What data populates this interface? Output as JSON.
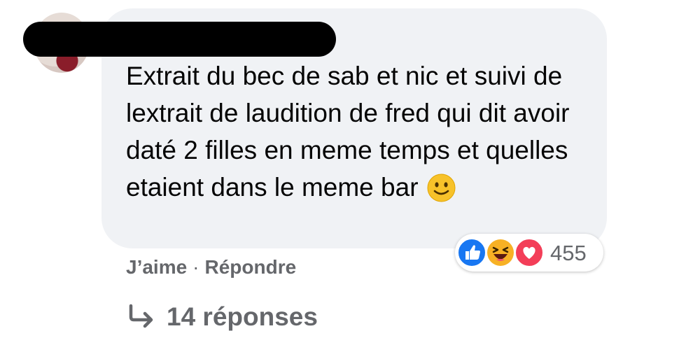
{
  "comment": {
    "text": "Extrait du bec de sab et nic et suivi de lextrait de laudition de fred qui dit avoir daté 2 filles en meme temps et quelles etaient dans le meme bar",
    "emoji": "slightly-smiling-face"
  },
  "reactions": {
    "icons": [
      "like-icon",
      "haha-icon",
      "love-icon"
    ],
    "count": "455"
  },
  "actions": {
    "like_label": "J’aime",
    "separator": "·",
    "reply_label": "Répondre"
  },
  "replies": {
    "label": "14 réponses",
    "icon": "reply-arrow-icon"
  },
  "colors": {
    "bubble": "#f0f2f5",
    "secondary_text": "#65676b",
    "like_blue": "#1877f2",
    "love_red": "#f33e58",
    "haha_yellow": "#f7b125"
  }
}
